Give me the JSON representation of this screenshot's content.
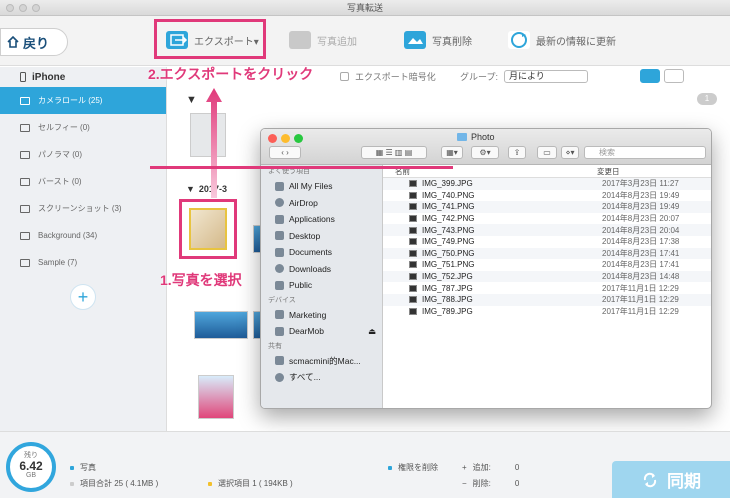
{
  "window": {
    "title": "写真転送"
  },
  "toolbar": {
    "back_label": "戻り",
    "export_label": "エクスポート▾",
    "add_label": "写真追加",
    "delete_label": "写真削除",
    "refresh_label": "最新の情報に更新"
  },
  "options": {
    "encrypt_label": "エクスポート暗号化",
    "group_label": "グループ:",
    "group_value": "月により"
  },
  "sidebar": {
    "device": "iPhone",
    "items": [
      {
        "label": "カメラロール (25)"
      },
      {
        "label": "セルフィー (0)"
      },
      {
        "label": "パノラマ (0)"
      },
      {
        "label": "バースト (0)"
      },
      {
        "label": "スクリーンショット (3)"
      },
      {
        "label": "Background (34)"
      },
      {
        "label": "Sample (7)"
      }
    ],
    "add_label": "+"
  },
  "main": {
    "section1_badge": "1",
    "section2_label": "2017-3"
  },
  "annotations": {
    "step2": "2.エクスポートをクリック",
    "step1": "1.写真を選択"
  },
  "finder": {
    "title": "Photo",
    "search_placeholder": "検索",
    "favorites_head": "よく使う項目",
    "favorites": [
      "All My Files",
      "AirDrop",
      "Applications",
      "Desktop",
      "Documents",
      "Downloads",
      "Public"
    ],
    "devices_head": "デバイス",
    "devices": [
      "Marketing",
      "DearMob"
    ],
    "shared_head": "共有",
    "shared": [
      "scmacmini的Mac...",
      "すべて..."
    ],
    "col_name": "名前",
    "col_date": "変更日",
    "files": [
      {
        "name": "IMG_399.JPG",
        "date": "2017年3月23日 11:27"
      },
      {
        "name": "IMG_740.PNG",
        "date": "2014年8月23日 19:49"
      },
      {
        "name": "IMG_741.PNG",
        "date": "2014年8月23日 19:49"
      },
      {
        "name": "IMG_742.PNG",
        "date": "2014年8月23日 20:07"
      },
      {
        "name": "IMG_743.PNG",
        "date": "2014年8月23日 20:04"
      },
      {
        "name": "IMG_749.PNG",
        "date": "2014年8月23日 17:38"
      },
      {
        "name": "IMG_750.PNG",
        "date": "2014年8月23日 17:41"
      },
      {
        "name": "IMG_751.PNG",
        "date": "2014年8月23日 17:41"
      },
      {
        "name": "IMG_752.JPG",
        "date": "2014年8月23日 14:48"
      },
      {
        "name": "IMG_787.JPG",
        "date": "2017年11月1日 12:29"
      },
      {
        "name": "IMG_788.JPG",
        "date": "2017年11月1日 12:29"
      },
      {
        "name": "IMG_789.JPG",
        "date": "2017年11月1日 12:29"
      }
    ]
  },
  "status": {
    "storage_label": "残り",
    "storage_value": "6.42",
    "storage_unit": "GB",
    "photos_label": "写真",
    "total_items": "項目合計 25 ( 4.1MB )",
    "selected_items": "選択項目 1 ( 194KB )",
    "permission_label": "権限を削除",
    "added_label": "追加:",
    "added_value": "0",
    "deleted_label": "削除:",
    "deleted_value": "0",
    "sync_label": "同期"
  },
  "colors": {
    "accent": "#2ea5da",
    "annotation": "#e0397a"
  }
}
